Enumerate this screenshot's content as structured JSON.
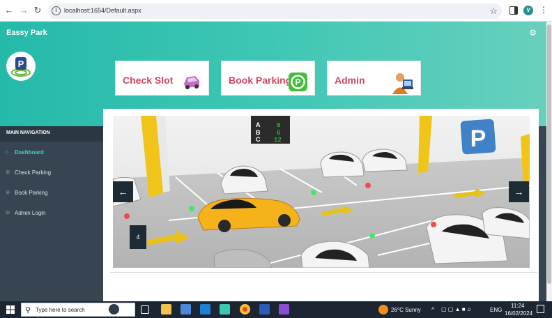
{
  "browser": {
    "url": "localhost:1654/Default.aspx",
    "profile_initial": "V"
  },
  "app": {
    "title": "Eassy Park"
  },
  "sidebar": {
    "heading": "MAIN NAVIGATION",
    "items": [
      {
        "label": "Dashboard",
        "icon": "home-icon",
        "active": true
      },
      {
        "label": "Check Parking",
        "icon": "user-icon",
        "active": false
      },
      {
        "label": "Book Parking",
        "icon": "user-icon",
        "active": false
      },
      {
        "label": "Admin Login",
        "icon": "user-icon",
        "active": false
      }
    ]
  },
  "tiles": [
    {
      "label": "Check Slot",
      "icon": "car-icon"
    },
    {
      "label": "Book Parking",
      "icon": "parking-p-icon"
    },
    {
      "label": "Admin",
      "icon": "admin-person-icon"
    }
  ],
  "carousel": {
    "slide_number": "4",
    "sign_rows": [
      {
        "letter": "A",
        "count": "0"
      },
      {
        "letter": "B",
        "count": "6"
      },
      {
        "letter": "C",
        "count": "12"
      }
    ],
    "sign_letter": "P"
  },
  "taskbar": {
    "search_placeholder": "Type here to search",
    "weather": "26°C  Sunny",
    "language": "ENG",
    "time": "11:24",
    "date": "16/02/2024"
  },
  "colors": {
    "header_start": "#25b9a9",
    "header_end": "#68d0bd",
    "sidebar": "#364551",
    "tile_text": "#d6435d",
    "active_nav": "#3fd1c1"
  }
}
